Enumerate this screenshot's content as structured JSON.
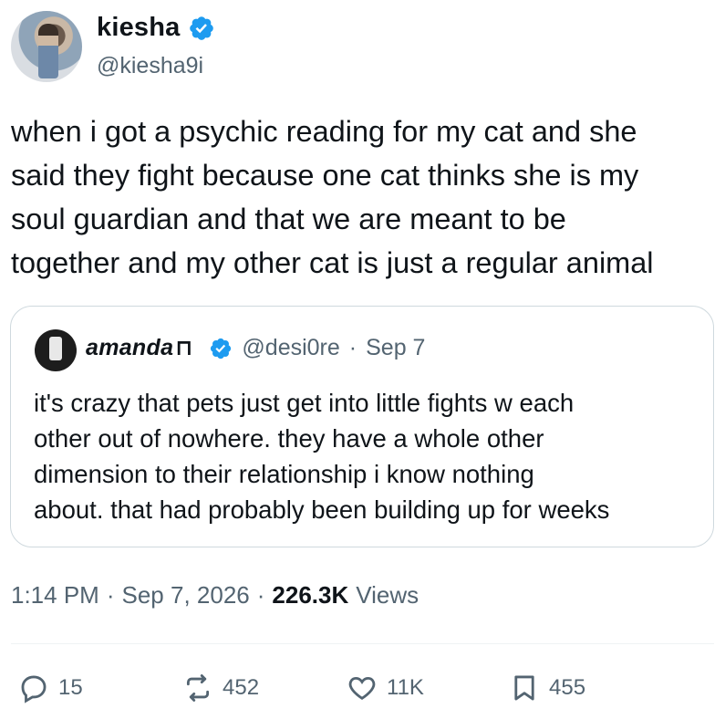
{
  "author": {
    "name": "kiesha",
    "handle": "@kiesha9i"
  },
  "tweet": {
    "text": "when i got a psychic reading for my cat and she\nsaid they fight because one cat thinks she is my\nsoul guardian and that we are meant to be\ntogether and my other cat is just a regular animal"
  },
  "quote": {
    "name": "amanda",
    "handle": "@desi0re",
    "separator": "·",
    "date": "Sep 7",
    "text": "it's crazy that pets just get into little fights w each\nother out of nowhere. they have a whole other\ndimension to their relationship i know nothing\nabout. that had probably been building up for weeks"
  },
  "meta": {
    "time": "1:14 PM",
    "sep1": "·",
    "date": "Sep 7, 2026",
    "sep2": "·",
    "views_count": "226.3K",
    "views_label": "Views"
  },
  "actions": {
    "replies": "15",
    "reposts": "452",
    "likes": "11K",
    "bookmarks": "455"
  },
  "colors": {
    "verified": "#1d9bf0",
    "secondary_text": "#536471",
    "border": "#cfd9de"
  },
  "icons": [
    "verified-badge-icon",
    "reply-icon",
    "repost-icon",
    "like-icon",
    "bookmark-icon"
  ]
}
